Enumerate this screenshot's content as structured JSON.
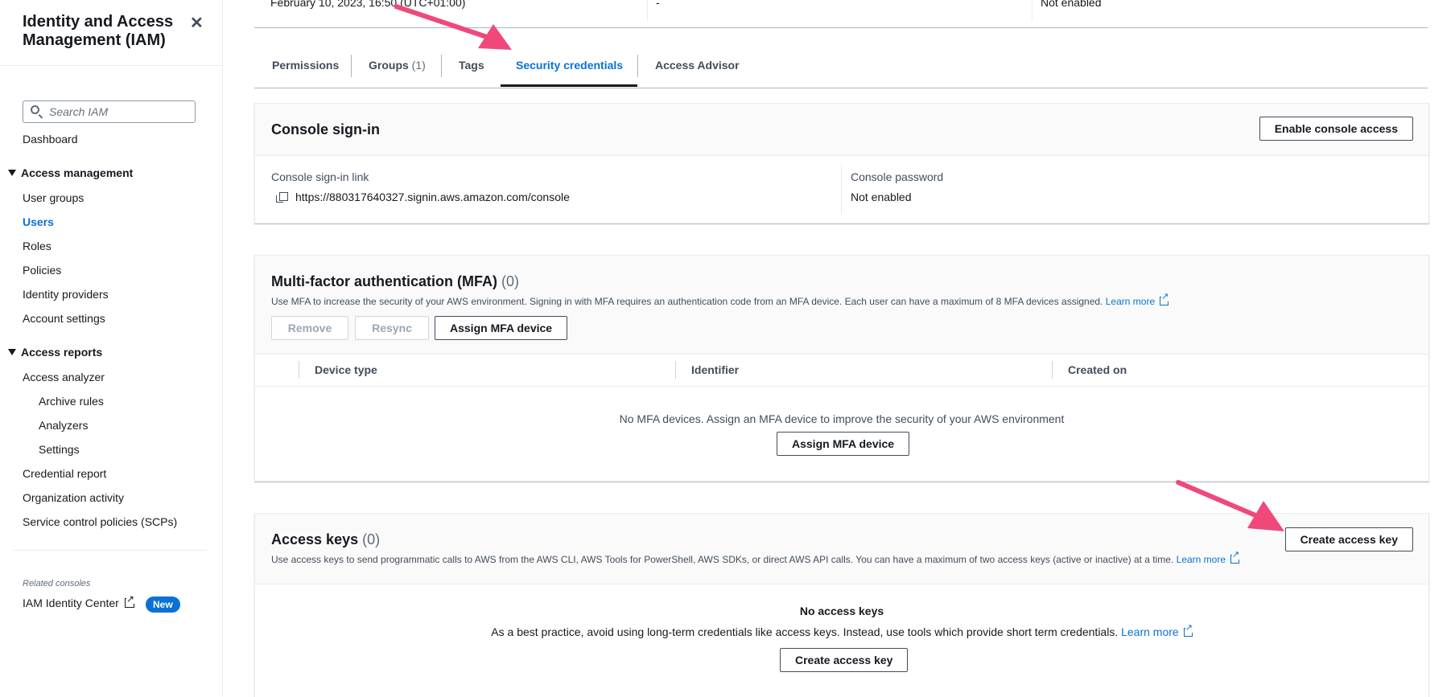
{
  "sidebar": {
    "title": "Identity and Access Management (IAM)",
    "search_placeholder": "Search IAM",
    "dashboard": "Dashboard",
    "access_management": {
      "heading": "Access management",
      "items": [
        "User groups",
        "Users",
        "Roles",
        "Policies",
        "Identity providers",
        "Account settings"
      ],
      "active": "Users"
    },
    "access_reports": {
      "heading": "Access reports",
      "analyzer": "Access analyzer",
      "sub_items": [
        "Archive rules",
        "Analyzers",
        "Settings"
      ],
      "items": [
        "Credential report",
        "Organization activity",
        "Service control policies (SCPs)"
      ]
    },
    "related_label": "Related consoles",
    "identity_center": "IAM Identity Center",
    "new_badge": "New"
  },
  "top_row": {
    "created": "February 10, 2023, 16:50 (UTC+01:00)",
    "middle": "-",
    "right": "Not enabled"
  },
  "tabs": [
    {
      "label": "Permissions",
      "count": ""
    },
    {
      "label": "Groups",
      "count": "(1)"
    },
    {
      "label": "Tags",
      "count": ""
    },
    {
      "label": "Security credentials",
      "count": ""
    },
    {
      "label": "Access Advisor",
      "count": ""
    }
  ],
  "active_tab": "Security credentials",
  "console_signin": {
    "title": "Console sign-in",
    "enable_button": "Enable console access",
    "link_label": "Console sign-in link",
    "link_value": "https://880317640327.signin.aws.amazon.com/console",
    "password_label": "Console password",
    "password_value": "Not enabled"
  },
  "mfa": {
    "title": "Multi-factor authentication (MFA)",
    "count": "(0)",
    "description": "Use MFA to increase the security of your AWS environment. Signing in with MFA requires an authentication code from an MFA device. Each user can have a maximum of 8 MFA devices assigned.",
    "learn_more": "Learn more",
    "remove_button": "Remove",
    "resync_button": "Resync",
    "assign_button": "Assign MFA device",
    "columns": [
      "Device type",
      "Identifier",
      "Created on"
    ],
    "empty_text": "No MFA devices. Assign an MFA device to improve the security of your AWS environment",
    "empty_button": "Assign MFA device"
  },
  "access_keys": {
    "title": "Access keys",
    "count": "(0)",
    "description": "Use access keys to send programmatic calls to AWS from the AWS CLI, AWS Tools for PowerShell, AWS SDKs, or direct AWS API calls. You can have a maximum of two access keys (active or inactive) at a time.",
    "learn_more": "Learn more",
    "create_button": "Create access key",
    "empty_title": "No access keys",
    "empty_text": "As a best practice, avoid using long-term credentials like access keys. Instead, use tools which provide short term credentials.",
    "empty_learn_more": "Learn more",
    "empty_button": "Create access key"
  },
  "colors": {
    "accent": "#0972d3",
    "annotation_arrow": "#f0487a"
  }
}
